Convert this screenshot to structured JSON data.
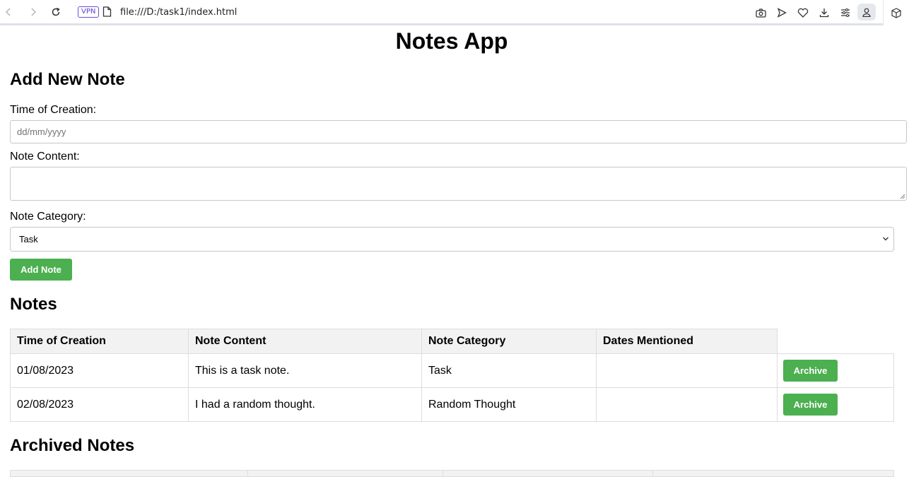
{
  "browser": {
    "url": "file:///D:/task1/index.html",
    "vpn_label": "VPN"
  },
  "page": {
    "title": "Notes App",
    "add_section": {
      "heading": "Add New Note",
      "time_label": "Time of Creation:",
      "time_placeholder": "dd/mm/yyyy",
      "content_label": "Note Content:",
      "category_label": "Note Category:",
      "category_selected": "Task",
      "add_button": "Add Note"
    },
    "notes_section": {
      "heading": "Notes",
      "columns": [
        "Time of Creation",
        "Note Content",
        "Note Category",
        "Dates Mentioned"
      ],
      "rows": [
        {
          "time": "01/08/2023",
          "content": "This is a task note.",
          "category": "Task",
          "dates": "",
          "action": "Archive"
        },
        {
          "time": "02/08/2023",
          "content": "I had a random thought.",
          "category": "Random Thought",
          "dates": "",
          "action": "Archive"
        }
      ]
    },
    "archived_section": {
      "heading": "Archived Notes"
    }
  },
  "colors": {
    "accent_green": "#4caf50",
    "header_bg": "#f2f2f2"
  }
}
